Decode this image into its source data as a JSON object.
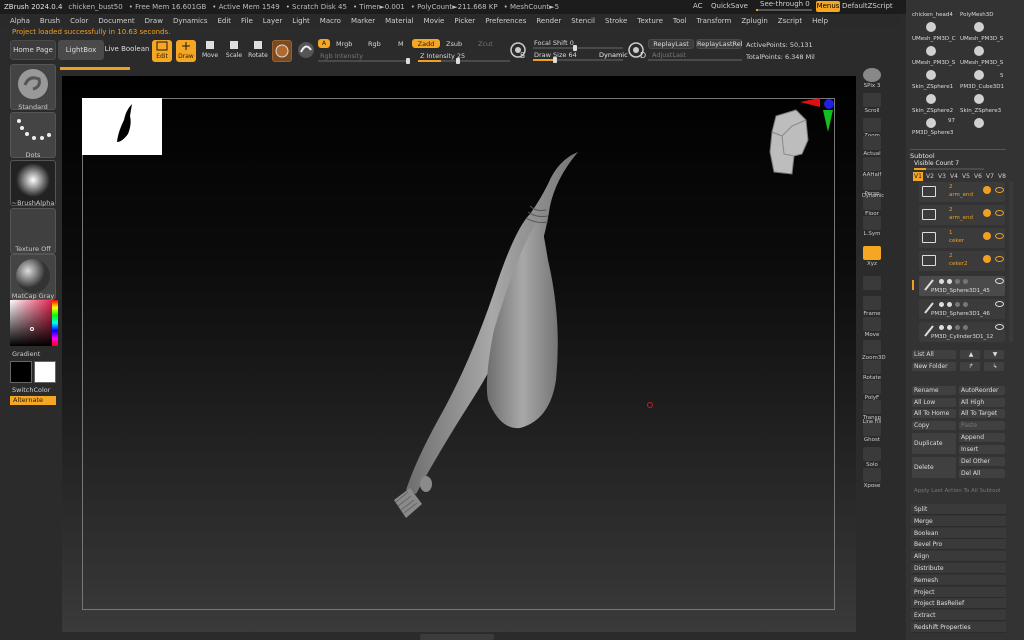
{
  "titlebar": {
    "app": "ZBrush 2024.0.4",
    "file": "chicken_bust50",
    "free_mem": "• Free Mem 16.601GB",
    "active_mem": "• Active Mem 1549",
    "scratch": "• Scratch Disk 45",
    "timer": "• Timer►0.001",
    "polycount": "• PolyCount►211.668 KP",
    "meshcount": "• MeshCount►5",
    "ac": "AC",
    "quicksave": "QuickSave",
    "seethrough": "See-through  0",
    "menus": "Menus",
    "script": "DefaultZScript"
  },
  "menubar": [
    "Alpha",
    "Brush",
    "Color",
    "Document",
    "Draw",
    "Dynamics",
    "Edit",
    "File",
    "Layer",
    "Light",
    "Macro",
    "Marker",
    "Material",
    "Movie",
    "Picker",
    "Preferences",
    "Render",
    "Stencil",
    "Stroke",
    "Texture",
    "Tool",
    "Transform",
    "Zplugin",
    "Zscript",
    "Help"
  ],
  "status_message": "Project loaded successfully in 10.63 seconds.",
  "shelf": {
    "home": "Home Page",
    "lightbox": "LightBox",
    "live_boolean": "Live Boolean",
    "edit": "Edit",
    "draw": "Draw",
    "move": "Move",
    "scale": "Scale",
    "rotate": "Rotate",
    "a": "A",
    "mrgb": "Mrgb",
    "rgb": "Rgb",
    "m": "M",
    "zadd": "Zadd",
    "zsub": "Zsub",
    "zcut": "Zcut",
    "rgb_intensity": "Rgb Intensity",
    "z_intensity": "Z Intensity 25",
    "focal_shift": "Focal Shift 0",
    "draw_size": "Draw Size 64",
    "dynamic": "Dynamic",
    "replay_last": "ReplayLast",
    "replay_last_rel": "ReplayLastRel",
    "adjust_last": "AdjustLast",
    "active_points": "ActivePoints: 50,131",
    "total_points": "TotalPoints: 6.348 Mil",
    "s": "S",
    "d": "D"
  },
  "left_tray": {
    "standard": "Standard",
    "dots": "Dots",
    "brush_alpha": "~BrushAlpha",
    "texture_off": "Texture Off",
    "matcap": "MatCap Gray",
    "gradient": "Gradient",
    "switch_color": "SwitchColor",
    "alternate": "Alternate"
  },
  "right_shelf": [
    "SPix 3",
    "Scroll",
    "Zoom",
    "Actual",
    "AAHalf",
    "Persp",
    "Floor",
    "L.Sym",
    "Xyz",
    "",
    "Frame",
    "Move",
    "Zoom3D",
    "Rotate",
    "PolyF",
    "Transp",
    "Ghost",
    "Solo",
    "Xpose"
  ],
  "right_shelf_extra": [
    "Dynamic",
    "Line Fill"
  ],
  "tool_thumbs": [
    {
      "label": "chicken_head4"
    },
    {
      "label": "PolyMesh3D"
    },
    {
      "label": "UMesh_PM3D_C"
    },
    {
      "label": "UMesh_PM3D_S"
    },
    {
      "label": "UMesh_PM3D_S"
    },
    {
      "label": "UMesh_PM3D_S"
    },
    {
      "label": "Skin_ZSphere1"
    },
    {
      "label": "PM3D_Cube3D1"
    },
    {
      "label": "Skin_ZSphere2"
    },
    {
      "label": "Skin_ZSphere3"
    },
    {
      "label": "PM3D_Sphere3"
    }
  ],
  "thumb_counts": {
    "five": "5",
    "ninety_seven": "97"
  },
  "subtool": {
    "header": "Subtool",
    "visible_count": "Visible Count 7",
    "versions": [
      "V1",
      "V2",
      "V3",
      "V4",
      "V5",
      "V6",
      "V7",
      "V8"
    ],
    "folders": [
      {
        "num": "2",
        "name": "arm_end"
      },
      {
        "num": "2",
        "name": "arm_end"
      },
      {
        "num": "1",
        "name": "ceker"
      },
      {
        "num": "2",
        "name": "ceker2"
      }
    ],
    "items": [
      "PM3D_Sphere3D1_45",
      "PM3D_Sphere3D1_46",
      "PM3D_Cylinder3D1_12"
    ],
    "buttons": {
      "list_all": "List All",
      "new_folder": "New Folder",
      "rename": "Rename",
      "auto_reorder": "AutoReorder",
      "all_low": "All Low",
      "all_high": "All High",
      "all_to_home": "All To Home",
      "all_to_target": "All To Target",
      "copy": "Copy",
      "paste": "Paste",
      "duplicate": "Duplicate",
      "append": "Append",
      "insert": "Insert",
      "delete": "Delete",
      "del_other": "Del Other",
      "del_all": "Del All",
      "apply_last": "Apply Last Action To All Subtool"
    }
  },
  "deformation_menu": [
    "Split",
    "Merge",
    "Boolean",
    "Bevel Pro",
    "Align",
    "Distribute",
    "Remesh",
    "Project",
    "Project BasRelief",
    "Extract",
    "Redshift Properties"
  ],
  "colors": {
    "accent": "#f5a623",
    "panel": "#333333",
    "canvas_top": "#000000",
    "canvas_bottom": "#3a3a3a",
    "axis_red": "#e01010",
    "axis_green": "#10c020",
    "axis_blue": "#2020e0"
  }
}
